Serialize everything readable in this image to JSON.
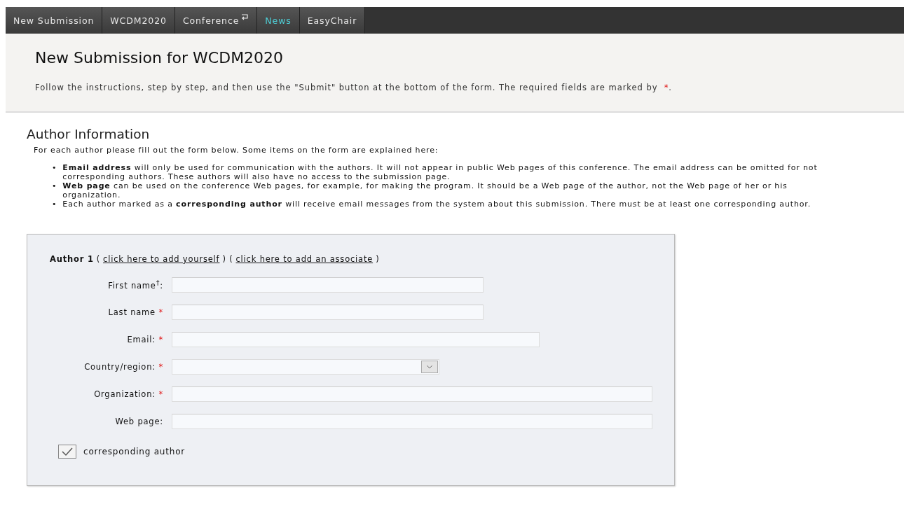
{
  "menu": [
    {
      "label": "New Submission",
      "selected": false
    },
    {
      "label": "WCDM2020",
      "selected": false
    },
    {
      "label": "Conference",
      "selected": false,
      "kind": "return-link"
    },
    {
      "label": "News",
      "selected": true
    },
    {
      "label": "EasyChair",
      "selected": false
    }
  ],
  "header": {
    "title": "New Submission for WCDM2020",
    "instructions": "Follow the instructions, step by step, and then use the \"Submit\" button at the bottom of the form. The required fields are marked by",
    "required_mark": "*",
    "end": "."
  },
  "author_info": {
    "heading": "Author Information",
    "intro": "For each author please fill out the form below. Some items on the form are explained here:",
    "marker": "•",
    "bullets": [
      "**Email address** will only be used for communication with the authors. It will not appear in public Web pages of this conference. The email address can be omitted for not corresponding authors. These authors will also have no access to the submission page.",
      "**Web page** can be used on the conference Web pages, for example, for making the program. It should be a Web page of the author, not the Web page of her or his organization.",
      "Each author marked as a **corresponding author** will receive email messages from the system about this submission. There must be at least one corresponding author."
    ]
  },
  "author_form": {
    "heading_parts": [
      {
        "kind": "bold",
        "text": "Author 1"
      },
      {
        "kind": "text",
        "text": "("
      },
      {
        "kind": "link",
        "text": "click here to add yourself"
      },
      {
        "kind": "text",
        "text": ") ("
      },
      {
        "kind": "link",
        "text": "click here to add an associate"
      },
      {
        "kind": "text",
        "text": ")"
      }
    ],
    "fields": [
      {
        "label": "First name$^{†}$:",
        "kind": "short"
      },
      {
        "label": "Last name",
        "mark": "*",
        "kind": "short"
      },
      {
        "label": "Email:",
        "mark": "*",
        "kind": "medium"
      },
      {
        "label": "Country/region:",
        "mark": "*",
        "kind": "select"
      },
      {
        "label": "Organization:",
        "mark": "*",
        "kind": "long"
      },
      {
        "label": "Web page:",
        "kind": "long"
      }
    ],
    "corresponding": {
      "label": "corresponding author",
      "checked": true
    }
  }
}
